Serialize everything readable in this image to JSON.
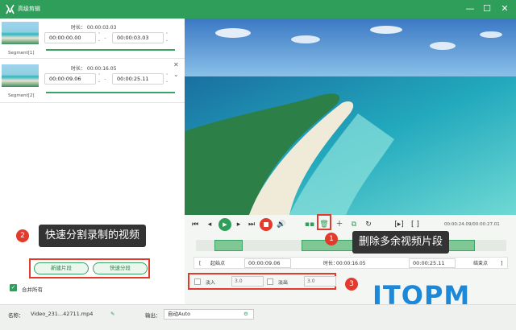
{
  "window": {
    "title": "高级剪辑",
    "minimize": "—",
    "maximize": "☐",
    "close": "✕"
  },
  "segments": [
    {
      "label": "Segment[1]",
      "duration": "时长： 00:00:03.03",
      "start": "00:00:00.00",
      "end": "00:00:03.03"
    },
    {
      "label": "Segment[2]",
      "duration": "时长： 00:00:16.05",
      "start": "00:00:09.06",
      "end": "00:00:25.11"
    }
  ],
  "segment_controls": {
    "close": "✕",
    "expand": "⌄"
  },
  "callouts": {
    "split": {
      "number": "2",
      "text": "快速分割录制的视频"
    },
    "delete": {
      "number": "1",
      "text": "删除多余视频片段"
    },
    "fade": {
      "number": "3"
    }
  },
  "buttons": {
    "new_segment": "新建片段",
    "quick_split": "快速分段"
  },
  "merge": {
    "label": "合并所有",
    "checked": true
  },
  "player": {
    "time_display": "00:00:24.09/00:00:27.01"
  },
  "timeline": {
    "clips": [
      0.06,
      0.34
    ]
  },
  "range": {
    "start_label": "起始点",
    "start_value": "00:00:09.06",
    "duration_label": "时长：",
    "duration_value": "00:00:16.05",
    "end_value": "00:00:25.11",
    "end_label": "结束点"
  },
  "fade": {
    "fade_in_label": "淡入",
    "fade_in_value": "3.0",
    "fade_out_label": "淡出",
    "fade_out_value": "3.0"
  },
  "watermark": "ITOPM",
  "bottom": {
    "name_label": "名称：",
    "name_value": "Video_231...42711.mp4",
    "output_label": "输出：",
    "output_value": "自动Auto"
  },
  "colors": {
    "accent": "#2f9e5a",
    "highlight": "#e23a2d",
    "brand": "#1e88d8"
  }
}
